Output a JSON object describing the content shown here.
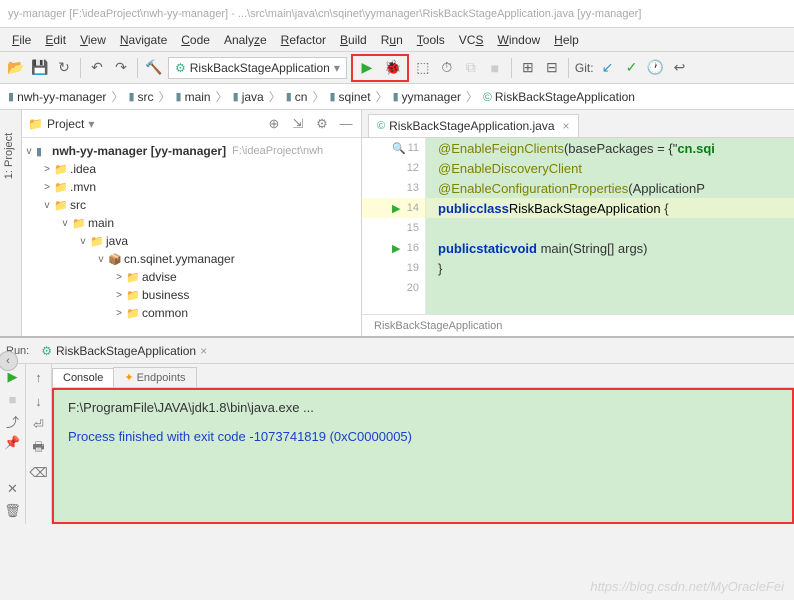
{
  "titlebar": "yy-manager [F:\\ideaProject\\nwh-yy-manager] - ...\\src\\main\\java\\cn\\sqinet\\yymanager\\RiskBackStageApplication.java [yy-manager]",
  "menu": {
    "file": "File",
    "edit": "Edit",
    "view": "View",
    "navigate": "Navigate",
    "code": "Code",
    "analyze": "Analyze",
    "refactor": "Refactor",
    "build": "Build",
    "run": "Run",
    "tools": "Tools",
    "vcs": "VCS",
    "window": "Window",
    "help": "Help"
  },
  "toolbar": {
    "run_config": "RiskBackStageApplication",
    "git_label": "Git:"
  },
  "breadcrumbs": [
    "nwh-yy-manager",
    "src",
    "main",
    "java",
    "cn",
    "sqinet",
    "yymanager",
    "RiskBackStageApplication"
  ],
  "project": {
    "title": "Project",
    "root": {
      "label": "nwh-yy-manager",
      "tag": "[yy-manager]",
      "path": "F:\\ideaProject\\nwh"
    },
    "items": [
      {
        "ind": 1,
        "exp": ">",
        "ico": "📁",
        "label": ".idea"
      },
      {
        "ind": 1,
        "exp": ">",
        "ico": "📁",
        "label": ".mvn"
      },
      {
        "ind": 1,
        "exp": "v",
        "ico": "📁",
        "label": "src"
      },
      {
        "ind": 2,
        "exp": "v",
        "ico": "📁",
        "label": "main"
      },
      {
        "ind": 3,
        "exp": "v",
        "ico": "📁",
        "label": "java"
      },
      {
        "ind": 4,
        "exp": "v",
        "ico": "📦",
        "label": "cn.sqinet.yymanager"
      },
      {
        "ind": 5,
        "exp": ">",
        "ico": "📁",
        "label": "advise"
      },
      {
        "ind": 5,
        "exp": ">",
        "ico": "📁",
        "label": "business"
      },
      {
        "ind": 5,
        "exp": ">",
        "ico": "📁",
        "label": "common"
      }
    ]
  },
  "editor": {
    "tab": "RiskBackStageApplication.java",
    "breadcrumb": "RiskBackStageApplication",
    "lines": [
      {
        "n": 11,
        "mark": "🔍",
        "html": "<span class='anno'>@EnableFeignClients</span>(basePackages = {\"<span class='str'>cn.sqi</span>"
      },
      {
        "n": 12,
        "html": "<span class='anno'>@EnableDiscoveryClient</span>"
      },
      {
        "n": 13,
        "html": "<span class='anno'>@EnableConfigurationProperties</span>(ApplicationP"
      },
      {
        "n": 14,
        "cur": true,
        "mark": "▶",
        "html": "<span class='kw'>public</span> <span class='kw'>class</span> <span class='type'>RiskBackStageApplication</span> {"
      },
      {
        "n": 15,
        "html": ""
      },
      {
        "n": 16,
        "mark": "▶",
        "html": "    <span class='kw'>public</span> <span class='kw'>static</span> <span class='kw'>void</span> main(String[] args)"
      },
      {
        "n": 19,
        "html": "}"
      },
      {
        "n": 20,
        "html": ""
      }
    ]
  },
  "run": {
    "label": "Run:",
    "config": "RiskBackStageApplication",
    "console_tab": "Console",
    "endpoints_tab": "Endpoints",
    "output1": "F:\\ProgramFile\\JAVA\\jdk1.8\\bin\\java.exe ...",
    "output2": "Process finished with exit code -1073741819 (0xC0000005)"
  },
  "watermark": "https://blog.csdn.net/MyOracleFei"
}
